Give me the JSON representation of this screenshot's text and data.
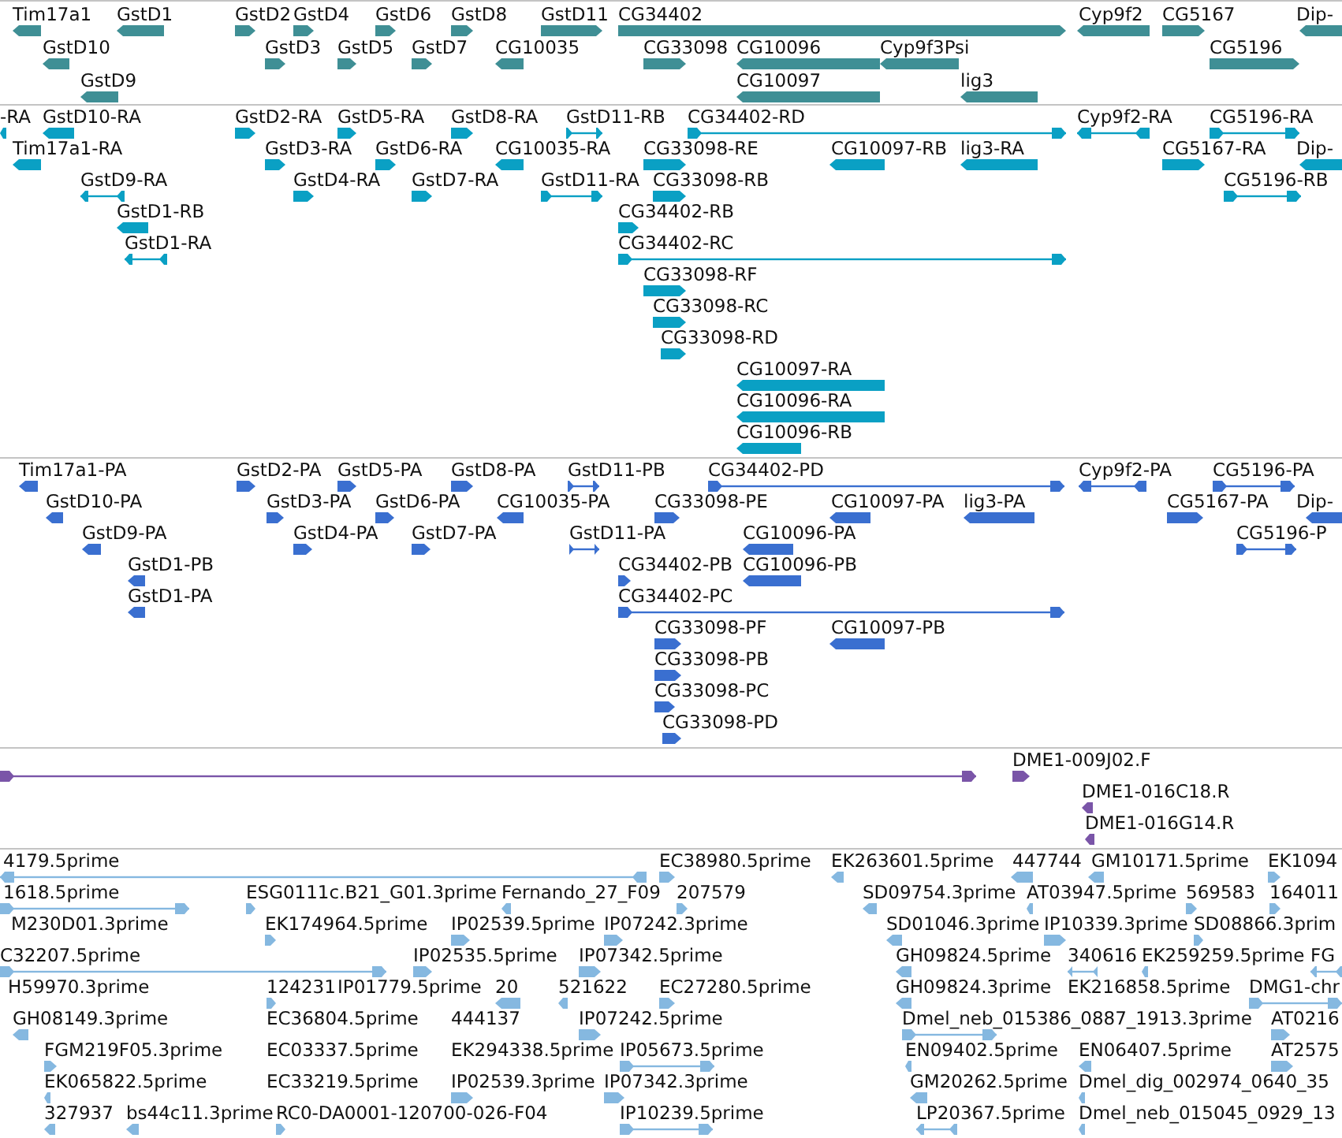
{
  "tracks": [
    {
      "kind": "gene",
      "color": "#3f8f95",
      "features": [
        {
          "label": "Tim17a1",
          "reverse": true
        },
        {
          "label": "GstD1",
          "reverse": true
        },
        {
          "label": "GstD2",
          "reverse": false
        },
        {
          "label": "GstD4",
          "reverse": false
        },
        {
          "label": "GstD6",
          "reverse": false
        },
        {
          "label": "GstD8",
          "reverse": false
        },
        {
          "label": "GstD11",
          "reverse": false
        },
        {
          "label": "CG34402",
          "reverse": false
        },
        {
          "label": "Cyp9f2",
          "reverse": true
        },
        {
          "label": "CG5167",
          "reverse": false
        },
        {
          "label": "Dip-",
          "reverse": true
        },
        {
          "label": "GstD10",
          "reverse": true
        },
        {
          "label": "GstD3",
          "reverse": false
        },
        {
          "label": "GstD5",
          "reverse": false
        },
        {
          "label": "GstD7",
          "reverse": false
        },
        {
          "label": "CG10035",
          "reverse": true
        },
        {
          "label": "CG33098",
          "reverse": false
        },
        {
          "label": "CG10096",
          "reverse": true
        },
        {
          "label": "Cyp9f3Psi",
          "reverse": true
        },
        {
          "label": "CG5196",
          "reverse": false
        },
        {
          "label": "GstD9",
          "reverse": true
        },
        {
          "label": "CG10097",
          "reverse": true
        },
        {
          "label": "lig3",
          "reverse": true
        }
      ]
    },
    {
      "kind": "transcript",
      "color": "#0aa0c4",
      "features": [
        {
          "label": "-RA",
          "reverse": true
        },
        {
          "label": "GstD10-RA",
          "reverse": true
        },
        {
          "label": "GstD2-RA",
          "reverse": false
        },
        {
          "label": "GstD5-RA",
          "reverse": false
        },
        {
          "label": "GstD8-RA",
          "reverse": false
        },
        {
          "label": "GstD11-RB",
          "reverse": false
        },
        {
          "label": "CG34402-RD",
          "reverse": false
        },
        {
          "label": "Cyp9f2-RA",
          "reverse": true
        },
        {
          "label": "CG5196-RA",
          "reverse": false
        },
        {
          "label": "Tim17a1-RA",
          "reverse": true
        },
        {
          "label": "GstD3-RA",
          "reverse": false
        },
        {
          "label": "GstD6-RA",
          "reverse": false
        },
        {
          "label": "CG10035-RA",
          "reverse": true
        },
        {
          "label": "CG33098-RE",
          "reverse": false
        },
        {
          "label": "CG10097-RB",
          "reverse": true
        },
        {
          "label": "lig3-RA",
          "reverse": true
        },
        {
          "label": "CG5167-RA",
          "reverse": false
        },
        {
          "label": "Dip-",
          "reverse": true
        },
        {
          "label": "GstD9-RA",
          "reverse": true
        },
        {
          "label": "GstD4-RA",
          "reverse": false
        },
        {
          "label": "GstD7-RA",
          "reverse": false
        },
        {
          "label": "GstD11-RA",
          "reverse": false
        },
        {
          "label": "CG33098-RB",
          "reverse": false
        },
        {
          "label": "CG5196-RB",
          "reverse": false
        },
        {
          "label": "GstD1-RB",
          "reverse": true
        },
        {
          "label": "CG34402-RB",
          "reverse": false
        },
        {
          "label": "GstD1-RA",
          "reverse": true
        },
        {
          "label": "CG34402-RC",
          "reverse": false
        },
        {
          "label": "CG33098-RF",
          "reverse": false
        },
        {
          "label": "CG33098-RC",
          "reverse": false
        },
        {
          "label": "CG33098-RD",
          "reverse": false
        },
        {
          "label": "CG10097-RA",
          "reverse": true
        },
        {
          "label": "CG10096-RA",
          "reverse": true
        },
        {
          "label": "CG10096-RB",
          "reverse": true
        }
      ]
    },
    {
      "kind": "protein",
      "color": "#3a6fd0",
      "features": [
        {
          "label": "Tim17a1-PA",
          "reverse": true
        },
        {
          "label": "GstD2-PA",
          "reverse": false
        },
        {
          "label": "GstD5-PA",
          "reverse": false
        },
        {
          "label": "GstD8-PA",
          "reverse": false
        },
        {
          "label": "GstD11-PB",
          "reverse": false
        },
        {
          "label": "CG34402-PD",
          "reverse": false
        },
        {
          "label": "Cyp9f2-PA",
          "reverse": true
        },
        {
          "label": "CG5196-PA",
          "reverse": false
        },
        {
          "label": "GstD10-PA",
          "reverse": true
        },
        {
          "label": "GstD3-PA",
          "reverse": false
        },
        {
          "label": "GstD6-PA",
          "reverse": false
        },
        {
          "label": "CG10035-PA",
          "reverse": true
        },
        {
          "label": "CG33098-PE",
          "reverse": false
        },
        {
          "label": "CG10097-PA",
          "reverse": true
        },
        {
          "label": "lig3-PA",
          "reverse": true
        },
        {
          "label": "CG5167-PA",
          "reverse": false
        },
        {
          "label": "Dip-",
          "reverse": true
        },
        {
          "label": "GstD9-PA",
          "reverse": true
        },
        {
          "label": "GstD4-PA",
          "reverse": false
        },
        {
          "label": "GstD7-PA",
          "reverse": false
        },
        {
          "label": "GstD11-PA",
          "reverse": false
        },
        {
          "label": "CG10096-PA",
          "reverse": true
        },
        {
          "label": "CG5196-P",
          "reverse": false
        },
        {
          "label": "GstD1-PB",
          "reverse": true
        },
        {
          "label": "CG34402-PB",
          "reverse": false
        },
        {
          "label": "CG10096-PB",
          "reverse": true
        },
        {
          "label": "GstD1-PA",
          "reverse": true
        },
        {
          "label": "CG34402-PC",
          "reverse": false
        },
        {
          "label": "CG33098-PF",
          "reverse": false
        },
        {
          "label": "CG10097-PB",
          "reverse": true
        },
        {
          "label": "CG33098-PB",
          "reverse": false
        },
        {
          "label": "CG33098-PC",
          "reverse": false
        },
        {
          "label": "CG33098-PD",
          "reverse": false
        }
      ]
    },
    {
      "kind": "clone",
      "color": "#7a55a8",
      "features": [
        {
          "reverse": false
        },
        {
          "label": "DME1-009J02.F",
          "reverse": false
        },
        {
          "label": "DME1-016C18.R",
          "reverse": true
        },
        {
          "label": "DME1-016G14.R",
          "reverse": true
        }
      ]
    },
    {
      "kind": "est",
      "color": "#85b8e0",
      "features": [
        {
          "label": "4179.5prime",
          "reverse": true
        },
        {
          "label": "EC38980.5prime",
          "reverse": false
        },
        {
          "label": "EK263601.5prime",
          "reverse": true
        },
        {
          "label": "447744",
          "reverse": true
        },
        {
          "label": "GM10171.5prime",
          "reverse": true
        },
        {
          "label": "EK1094",
          "reverse": false
        },
        {
          "label": "1618.5prime",
          "reverse": false
        },
        {
          "label": "ESG0111c.B21_G01.3prime",
          "reverse": false
        },
        {
          "label": "Fernando_27_F09",
          "reverse": true
        },
        {
          "label": "207579",
          "reverse": false
        },
        {
          "label": "SD09754.3prime",
          "reverse": true
        },
        {
          "label": "AT03947.5prime",
          "reverse": true
        },
        {
          "label": "569583",
          "reverse": false
        },
        {
          "label": "164011",
          "reverse": false
        },
        {
          "label": "M230D01.3prime"
        },
        {
          "label": "EK174964.5prime",
          "reverse": false
        },
        {
          "label": "IP02539.5prime",
          "reverse": false
        },
        {
          "label": "IP07242.3prime",
          "reverse": false
        },
        {
          "label": "SD01046.3prime",
          "reverse": true
        },
        {
          "label": "IP10339.3prime",
          "reverse": false
        },
        {
          "label": "SD08866.3prim",
          "reverse": false
        },
        {
          "label": "C32207.5prime",
          "reverse": false
        },
        {
          "label": "IP02535.5prime",
          "reverse": false
        },
        {
          "label": "IP07342.5prime",
          "reverse": false
        },
        {
          "label": "GH09824.5prime",
          "reverse": true
        },
        {
          "label": "340616",
          "reverse": true
        },
        {
          "label": "EK259259.5prime",
          "reverse": true
        },
        {
          "label": "FG",
          "reverse": true
        },
        {
          "label": "H59970.3prime"
        },
        {
          "label": "124231",
          "reverse": false
        },
        {
          "label": "IP01779.5prime"
        },
        {
          "label": "20",
          "reverse": true
        },
        {
          "label": "521622",
          "reverse": true
        },
        {
          "label": "EC27280.5prime",
          "reverse": false
        },
        {
          "label": "GH09824.3prime",
          "reverse": true
        },
        {
          "label": "EK216858.5prime"
        },
        {
          "label": "DMG1-chr",
          "reverse": false
        },
        {
          "label": "GH08149.3prime",
          "reverse": true
        },
        {
          "label": "EC36804.5prime"
        },
        {
          "label": "444137"
        },
        {
          "label": "IP07242.5prime",
          "reverse": false
        },
        {
          "label": "Dmel_neb_015386_0887_1913.3prime",
          "reverse": false
        },
        {
          "label": "AT0216",
          "reverse": false
        },
        {
          "label": "FGM219F05.3prime",
          "reverse": false
        },
        {
          "label": "EC03337.5prime"
        },
        {
          "label": "EK294338.5prime"
        },
        {
          "label": "IP05673.5prime",
          "reverse": false
        },
        {
          "label": "EN09402.5prime",
          "reverse": true
        },
        {
          "label": "EN06407.5prime",
          "reverse": true
        },
        {
          "label": "AT2575",
          "reverse": false
        },
        {
          "label": "EK065822.5prime",
          "reverse": true
        },
        {
          "label": "EC33219.5prime"
        },
        {
          "label": "IP02539.3prime",
          "reverse": false
        },
        {
          "label": "IP07342.3prime",
          "reverse": false
        },
        {
          "label": "GM20262.5prime",
          "reverse": true
        },
        {
          "label": "Dmel_dig_002974_0640_35",
          "reverse": true
        },
        {
          "label": "327937",
          "reverse": true
        },
        {
          "label": "bs44c11.3prime",
          "reverse": true
        },
        {
          "label": "RC0-DA0001-120700-026-F04",
          "reverse": false
        },
        {
          "label": "IP10239.5prime",
          "reverse": false
        },
        {
          "label": "LP20367.5prime",
          "reverse": true
        },
        {
          "label": "Dmel_neb_015045_0929_13",
          "reverse": true
        }
      ]
    }
  ]
}
